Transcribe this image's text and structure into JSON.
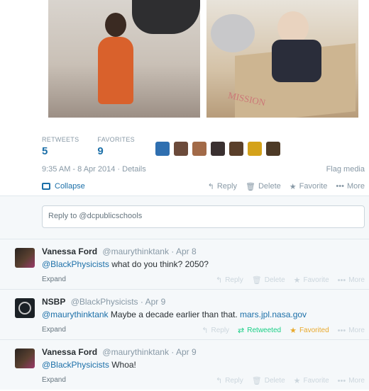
{
  "photos": {
    "second_photo_caption": "MISSION"
  },
  "stats": {
    "retweets_label": "RETWEETS",
    "retweets_value": "5",
    "favorites_label": "FAVORITES",
    "favorites_value": "9"
  },
  "favoriter_avatar_colors": [
    "#2f6fb0",
    "#6b4a3a",
    "#a26a48",
    "#3a3030",
    "#5a3f2a",
    "#d4a21a",
    "#4d3a26"
  ],
  "meta": {
    "timestamp": "9:35 AM - 8 Apr 2014 · Details",
    "flag": "Flag media"
  },
  "main_actions": {
    "collapse": "Collapse",
    "reply": "Reply",
    "delete": "Delete",
    "favorite": "Favorite",
    "more": "More"
  },
  "reply_box": {
    "placeholder": "Reply to @dcpublicschools"
  },
  "tweets": [
    {
      "name": "Vanessa Ford",
      "handle": "@maurythinktank",
      "date": "· Apr 8",
      "mention": "@BlackPhysicists",
      "text": " what do you think? 2050?",
      "expand": "Expand",
      "reply": "Reply",
      "delete": "Delete",
      "favorite": "Favorite",
      "more": "More"
    },
    {
      "name": "NSBP",
      "handle": "@BlackPhysicists",
      "date": "· Apr 9",
      "mention": "@maurythinktank",
      "text": " Maybe a decade earlier than that. ",
      "link": "mars.jpl.nasa.gov",
      "expand": "Expand",
      "reply": "Reply",
      "retweeted": "Retweeted",
      "favorited": "Favorited",
      "more": "More"
    },
    {
      "name": "Vanessa Ford",
      "handle": "@maurythinktank",
      "date": "· Apr 9",
      "mention": "@BlackPhysicists",
      "text": " Whoa!",
      "expand": "Expand",
      "reply": "Reply",
      "delete": "Delete",
      "favorite": "Favorite",
      "more": "More"
    }
  ],
  "colors": {
    "link_blue": "#1b6fa8",
    "retweet_green": "#19cf86",
    "favorite_gold": "#e9a92c",
    "muted": "#8899a6"
  }
}
